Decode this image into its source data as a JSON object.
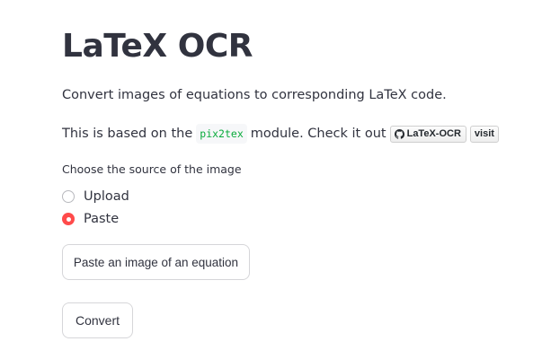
{
  "page": {
    "title": "LaTeX OCR",
    "description": "Convert images of equations to corresponding LaTeX code.",
    "based_on_prefix": "This is based on the",
    "module_name": "pix2tex",
    "based_on_suffix": "module. Check it out",
    "repo_badge_label": "LaTeX-OCR",
    "repo_badge_icon": "github-icon",
    "visit_badge_label": "visit"
  },
  "source": {
    "label": "Choose the source of the image",
    "options": [
      {
        "label": "Upload",
        "checked": false
      },
      {
        "label": "Paste",
        "checked": true
      }
    ]
  },
  "buttons": {
    "paste_label": "Paste an image of an equation",
    "convert_label": "Convert"
  },
  "colors": {
    "accent": "#ff4b4b",
    "text": "#31333f",
    "code": "#09ab3b"
  }
}
